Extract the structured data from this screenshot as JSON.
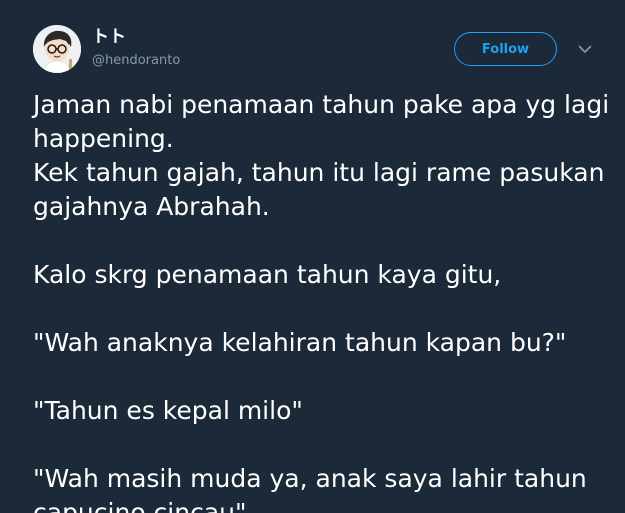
{
  "author": {
    "display_name": "トト",
    "handle": "@hendoranto"
  },
  "actions": {
    "follow_label": "Follow",
    "more_icon": "chevron-down-icon"
  },
  "colors": {
    "background": "#1c2938",
    "accent": "#1da1f2",
    "secondary_text": "#8899a6"
  },
  "tweet": {
    "lines": [
      "Jaman nabi penamaan tahun pake apa yg lagi",
      "happening.",
      "Kek tahun gajah, tahun itu lagi rame pasukan",
      "gajahnya Abrahah.",
      "Kalo skrg penamaan tahun kaya gitu,",
      "\"Wah anaknya kelahiran tahun kapan bu?\"",
      "\"Tahun es kepal milo\"",
      "\"Wah masih muda ya, anak saya lahir tahun",
      "capucino cincau\""
    ]
  }
}
